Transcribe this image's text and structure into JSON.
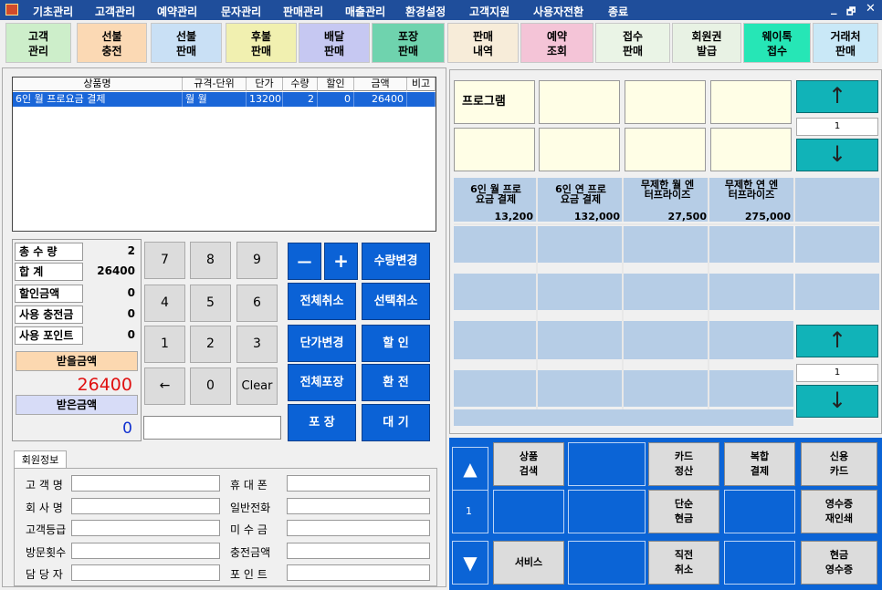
{
  "menu": {
    "items": [
      "기초관리",
      "고객관리",
      "예약관리",
      "문자관리",
      "판매관리",
      "매출관리",
      "환경설정",
      "고객지원",
      "사용자전환",
      "종료"
    ],
    "min_label": "_",
    "max_label": "🗗",
    "close_label": "✕"
  },
  "toolbar": {
    "buttons": [
      {
        "line1": "고객",
        "line2": "관리",
        "color": "#cdeeca"
      },
      {
        "line1": "선불",
        "line2": "충전",
        "color": "#fbd9b4"
      },
      {
        "line1": "선불",
        "line2": "판매",
        "color": "#c9e0f5"
      },
      {
        "line1": "후불",
        "line2": "판매",
        "color": "#f1f0b0"
      },
      {
        "line1": "배달",
        "line2": "판매",
        "color": "#c6c8f2"
      },
      {
        "line1": "포장",
        "line2": "판매",
        "color": "#6fd3ae"
      },
      {
        "line1": "판매",
        "line2": "내역",
        "color": "#f7ecd9"
      },
      {
        "line1": "예약",
        "line2": "조회",
        "color": "#f4c4d7"
      },
      {
        "line1": "접수",
        "line2": "판매",
        "color": "#eaf4e6"
      },
      {
        "line1": "회원권",
        "line2": "발급",
        "color": "#e8f2e4"
      },
      {
        "line1": "웨이톡",
        "line2": "접수",
        "color": "#26e6b6"
      },
      {
        "line1": "거래처",
        "line2": "판매",
        "color": "#c9e8f7"
      }
    ]
  },
  "grid": {
    "headers": [
      "상품명",
      "규격-단위",
      "단가",
      "수량",
      "할인",
      "금액",
      "비고"
    ],
    "row": {
      "name": "6인 월 프로요금 결제",
      "unit": "월 월",
      "price": "13200",
      "qty": "2",
      "discount": "0",
      "amount": "26400",
      "note": ""
    }
  },
  "summary": {
    "total_qty_label": "총 수 량",
    "total_qty": "2",
    "total_label": "합 계",
    "total": "26400",
    "discount_label": "할인금액",
    "discount": "0",
    "charge_label": "사용 충전금",
    "charge": "0",
    "point_label": "사용 포인트",
    "point": "0",
    "receive_label": "받을금액",
    "receive": "26400",
    "received_label": "받은금액",
    "received": "0"
  },
  "keypad": {
    "keys": [
      "7",
      "8",
      "9",
      "4",
      "5",
      "6",
      "1",
      "2",
      "3",
      "←",
      "0",
      "Clear"
    ]
  },
  "actions": {
    "minus": "—",
    "plus": "+",
    "qty_change": "수량변경",
    "cancel_all": "전체취소",
    "cancel_sel": "선택취소",
    "price_change": "단가변경",
    "discount": "할 인",
    "pack_all": "전체포장",
    "exchange": "환 전",
    "pack": "포 장",
    "wait": "대 기"
  },
  "member": {
    "tab": "회원정보",
    "left_labels": [
      "고 객 명",
      "회 사 명",
      "고객등급",
      "방문횟수",
      "담 당 자"
    ],
    "right_labels": [
      "휴 대 폰",
      "일반전화",
      "미 수 금",
      "충전금액",
      "포 인 트"
    ]
  },
  "program": {
    "label": "프로그램",
    "up_icon": "↑",
    "down_icon": "↓",
    "page": "1",
    "products": [
      {
        "line1": "6인 월 프로",
        "line2": "요금 결제",
        "price": "13,200"
      },
      {
        "line1": "6인 연 프로",
        "line2": "요금 결제",
        "price": "132,000"
      },
      {
        "line1": "무제한 월 엔",
        "line2": "터프라이즈",
        "price": "27,500"
      },
      {
        "line1": "무제한 연 엔",
        "line2": "터프라이즈",
        "price": "275,000"
      }
    ],
    "page2": "1"
  },
  "bottom": {
    "up_icon": "▲",
    "down_icon": "▼",
    "page": "1",
    "search_l1": "상품",
    "search_l2": "검색",
    "card_l1": "카드",
    "card_l2": "정산",
    "mixed_l1": "복합",
    "mixed_l2": "결제",
    "credit_l1": "신용",
    "credit_l2": "카드",
    "cash_l1": "단순",
    "cash_l2": "현금",
    "reprint_l1": "영수증",
    "reprint_l2": "재인쇄",
    "service": "서비스",
    "prev_cancel_l1": "직전",
    "prev_cancel_l2": "취소",
    "cash_receipt_l1": "현금",
    "cash_receipt_l2": "영수증"
  }
}
